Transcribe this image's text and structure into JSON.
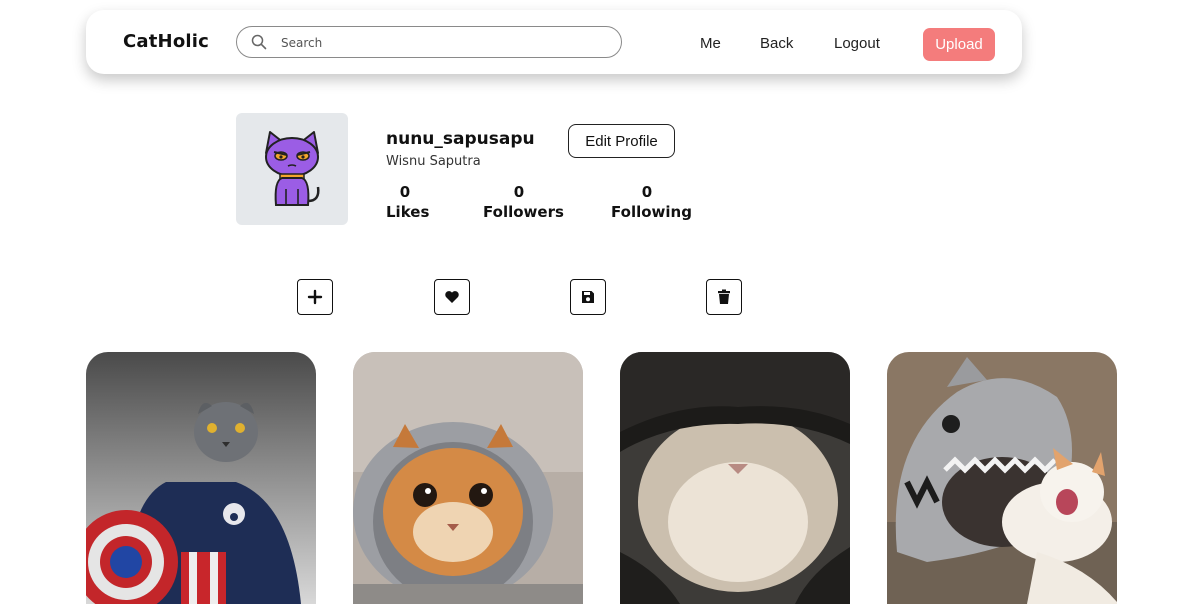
{
  "navbar": {
    "brand": "CatHolic",
    "search_placeholder": "Search",
    "links": [
      "Me",
      "Back",
      "Logout"
    ],
    "upload_label": "Upload",
    "upload_color": "#f47c7c"
  },
  "profile": {
    "username": "nunu_sapusapu",
    "full_name": "Wisnu Saputra",
    "edit_label": "Edit Profile",
    "stats": [
      {
        "value": "0",
        "label": "Likes"
      },
      {
        "value": "0",
        "label": "Followers"
      },
      {
        "value": "0",
        "label": "Following"
      }
    ]
  },
  "actions": [
    "plus-icon",
    "heart-icon",
    "save-icon",
    "trash-icon"
  ],
  "gallery": [
    {
      "name": "gallery-photo-1",
      "subject": "cat-in-captain-costume"
    },
    {
      "name": "gallery-photo-2",
      "subject": "orange-cat-in-hood"
    },
    {
      "name": "gallery-photo-3",
      "subject": "cat-in-black-beanie"
    },
    {
      "name": "gallery-photo-4",
      "subject": "kitten-in-shark-bed"
    }
  ]
}
